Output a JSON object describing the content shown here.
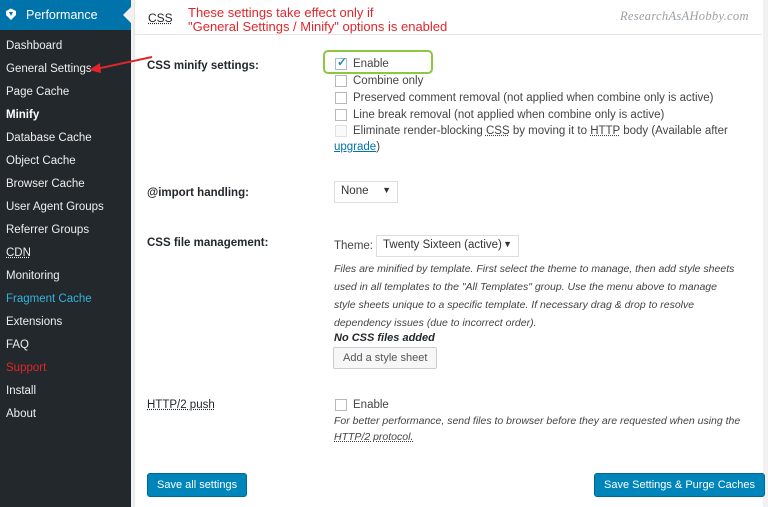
{
  "sidebar": {
    "header": "Performance",
    "items": [
      {
        "label": "Dashboard"
      },
      {
        "label": "General Settings"
      },
      {
        "label": "Page Cache"
      },
      {
        "label": "Minify"
      },
      {
        "label": "Database Cache"
      },
      {
        "label": "Object Cache"
      },
      {
        "label": "Browser Cache"
      },
      {
        "label": "User Agent Groups"
      },
      {
        "label": "Referrer Groups"
      },
      {
        "label": "CDN"
      },
      {
        "label": "Monitoring"
      },
      {
        "label": "Fragment Cache"
      },
      {
        "label": "Extensions"
      },
      {
        "label": "FAQ"
      },
      {
        "label": "Support"
      },
      {
        "label": "Install"
      },
      {
        "label": "About"
      }
    ]
  },
  "section": {
    "title": "CSS"
  },
  "watermark": "ResearchAsAHobby.com",
  "annotation": {
    "line1": "These settings take effect only if",
    "line2": "\"General Settings / Minify\" options is enabled"
  },
  "minify": {
    "label": "CSS minify settings:",
    "enable": "Enable",
    "combine_only": "Combine only",
    "preserve_comment": "Preserved comment removal (not applied when combine only is active)",
    "line_break": "Line break removal (not applied when combine only is active)",
    "eliminate_1": "Eliminate render-blocking",
    "eliminate_css": "CSS",
    "eliminate_2": "by moving it to",
    "eliminate_http": "HTTP",
    "eliminate_3": "body (Available after",
    "upgrade_link": "upgrade",
    "upgrade_close": ")"
  },
  "import": {
    "label": "@import handling:",
    "value": "None"
  },
  "files": {
    "label": "CSS file management:",
    "theme_label": "Theme:",
    "theme_value": "Twenty Sixteen (active)",
    "desc_1": "Files are minified by template. First select the theme to manage, then add style sheets",
    "desc_2": "used in all templates to the \"All Templates\" group. Use the menu above to manage",
    "desc_3": "style sheets unique to a specific template. If necessary drag & drop to resolve",
    "desc_4": "dependency issues (due to incorrect order).",
    "none_added": "No CSS files added",
    "add_button": "Add a style sheet"
  },
  "http2": {
    "label": "HTTP/2 push",
    "enable": "Enable",
    "desc_1": "For better performance, send files to browser before they are requested when using the",
    "desc_2": "HTTP/2 protocol."
  },
  "buttons": {
    "save_all": "Save all settings",
    "save_purge": "Save Settings & Purge Caches"
  },
  "colors": {
    "sidebar_bg": "#23282d",
    "accent": "#0073aa",
    "primary_button": "#0085ba",
    "annotation": "#e0262b",
    "highlight": "#8dc63f"
  }
}
